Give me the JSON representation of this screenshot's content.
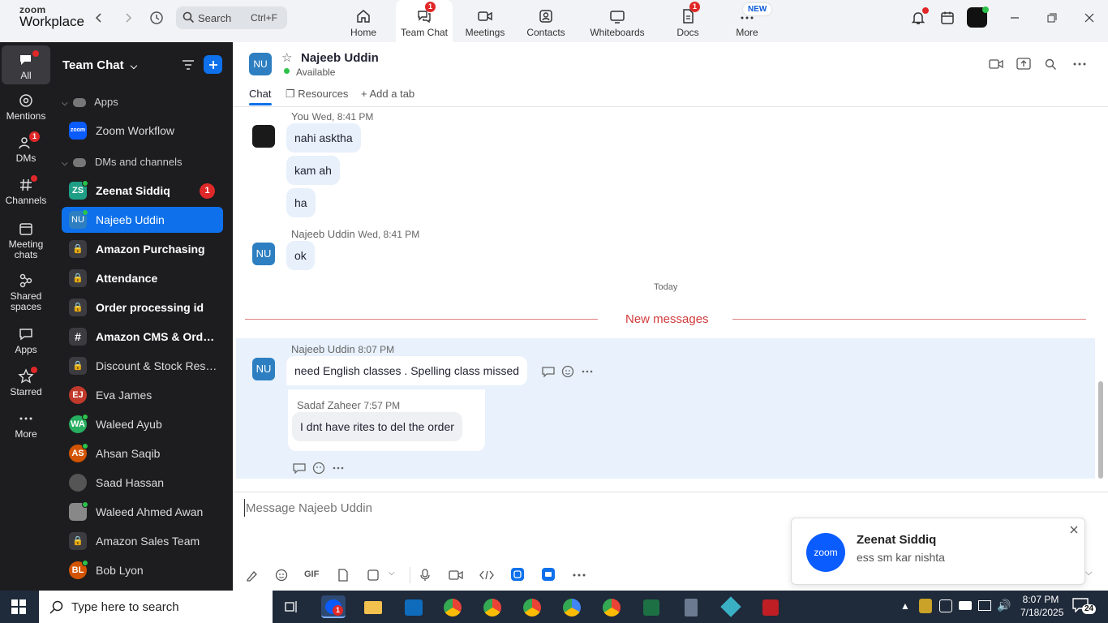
{
  "app": {
    "logo_line1": "zoom",
    "logo_line2": "Workplace"
  },
  "topbar": {
    "search_label": "Search",
    "search_shortcut": "Ctrl+F",
    "tabs": [
      {
        "label": "Home",
        "icon": "home-icon"
      },
      {
        "label": "Team Chat",
        "icon": "chat-icon",
        "badge": "1",
        "active": true
      },
      {
        "label": "Meetings",
        "icon": "video-icon"
      },
      {
        "label": "Contacts",
        "icon": "contacts-icon"
      },
      {
        "label": "Whiteboards",
        "icon": "whiteboard-icon"
      },
      {
        "label": "Docs",
        "icon": "docs-icon",
        "badge": "1"
      },
      {
        "label": "More",
        "icon": "more-icon",
        "badge_text": "NEW"
      }
    ]
  },
  "rail": {
    "items": [
      {
        "label": "All",
        "icon": "chat-bubble-icon"
      },
      {
        "label": "Mentions",
        "icon": "at-icon"
      },
      {
        "label": "DMs",
        "icon": "people-icon",
        "badge": "1"
      },
      {
        "label": "Channels",
        "icon": "hash-icon"
      },
      {
        "label": "Meeting chats",
        "line1": "Meeting",
        "line2": "chats",
        "icon": "calendar-icon"
      },
      {
        "label": "Shared spaces",
        "line1": "Shared",
        "line2": "spaces",
        "icon": "shared-icon"
      },
      {
        "label": "Apps",
        "icon": "apps-icon"
      },
      {
        "label": "Starred",
        "icon": "star-icon"
      },
      {
        "label": "More",
        "icon": "more-dots-icon"
      }
    ]
  },
  "sidebar": {
    "title": "Team Chat",
    "section_apps": "Apps",
    "section_dms": "DMs and channels",
    "app_items": [
      {
        "label": "Zoom Workflow",
        "avatar": "zoom"
      }
    ],
    "items": [
      {
        "label": "Zeenat Siddiq",
        "avatar": "ZS",
        "color": "#1f9e86",
        "count": "1",
        "bold": true
      },
      {
        "label": "Najeeb Uddin",
        "avatar": "NU",
        "color": "#2d7fc1",
        "selected": true
      },
      {
        "label": "Amazon Purchasing",
        "lock": true,
        "bold": true
      },
      {
        "label": "Attendance",
        "lock": true,
        "bold": true
      },
      {
        "label": "Order processing id",
        "lock": true,
        "bold": true
      },
      {
        "label": "Amazon CMS & Order...",
        "hash": true,
        "bold": true
      },
      {
        "label": "Discount & Stock Reser...",
        "lock": true
      },
      {
        "label": "Eva James",
        "avatar": "EJ",
        "color": "#c0392b"
      },
      {
        "label": "Waleed Ayub",
        "avatar": "WA",
        "color": "#27ae60"
      },
      {
        "label": "Ahsan Saqib",
        "avatar": "AS",
        "color": "#d35400"
      },
      {
        "label": "Saad Hassan",
        "avatar": "",
        "color": "#555"
      },
      {
        "label": "Waleed Ahmed Awan",
        "avatar": "",
        "color": "#777"
      },
      {
        "label": "Amazon Sales Team",
        "lock": true
      },
      {
        "label": "Bob Lyon",
        "avatar": "BL",
        "color": "#d35400"
      }
    ]
  },
  "chat": {
    "contact_initials": "NU",
    "contact_name": "Najeeb Uddin",
    "status": "Available",
    "tabs": {
      "chat": "Chat",
      "resources": "Resources",
      "add_tab": "Add a tab"
    },
    "messages_old": {
      "you_name": "You",
      "you_time": "Wed, 8:41 PM",
      "you_bubbles": [
        "nahi asktha",
        "kam ah",
        "ha"
      ],
      "nu_name": "Najeeb Uddin",
      "nu_time": "Wed, 8:41 PM",
      "nu_bubble": "ok"
    },
    "today_label": "Today",
    "new_messages_label": "New messages",
    "new_message": {
      "name": "Najeeb Uddin",
      "time": "8:07 PM",
      "text": "need English classes . Spelling class missed",
      "quote_name": "Sadaf Zaheer",
      "quote_time": "7:57 PM",
      "quote_text": "I dnt have rites to del the order"
    }
  },
  "composer": {
    "placeholder": "Message Najeeb Uddin",
    "gif_label": "GIF"
  },
  "notification": {
    "logo": "zoom",
    "title": "Zeenat Siddiq",
    "body": "ess sm kar nishta"
  },
  "taskbar": {
    "search_placeholder": "Type here to search",
    "time": "8:07 PM",
    "date": "7/18/2025",
    "notif_count": "24",
    "zoom_badge": "1"
  }
}
